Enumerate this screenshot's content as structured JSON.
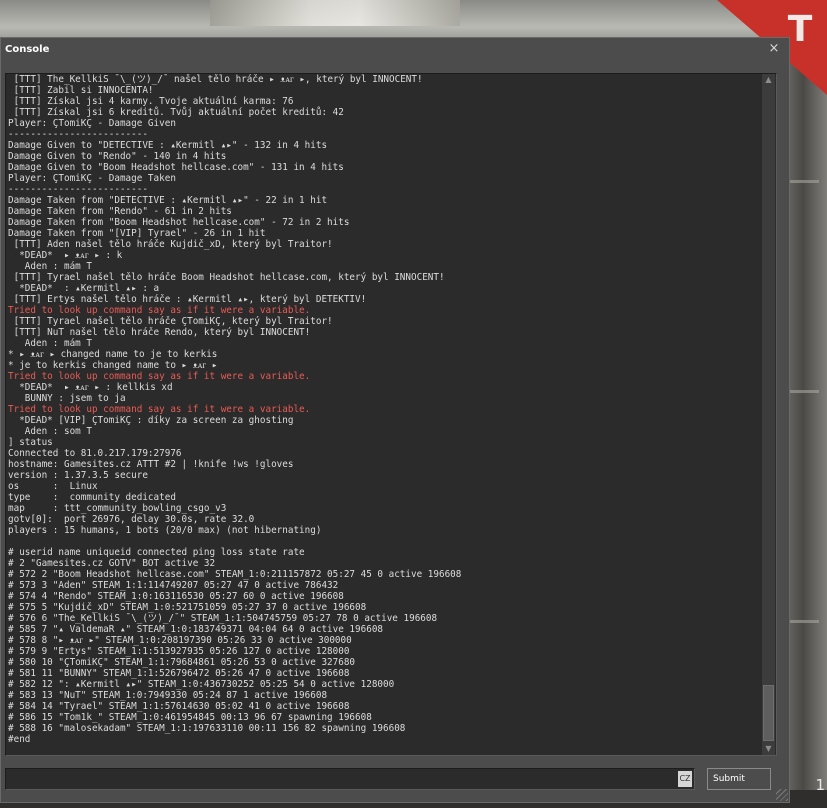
{
  "window": {
    "title": "Console",
    "close_glyph": "×"
  },
  "console_lines": [
    {
      "text": " [TTT] The_KellkiS ¯\\_(ツ)_/¯ našel tělo hráče ▸ ᴥᴀᴦ ▸, který byl INNOCENT!",
      "red": false
    },
    {
      "text": " [TTT] Zabil si INNOCENTA!",
      "red": false
    },
    {
      "text": " [TTT] Získal jsi 4 karmy. Tvoje aktuální karma: 76",
      "red": false
    },
    {
      "text": " [TTT] Získal jsi 6 kreditů. Tvůj aktuální počet kreditů: 42",
      "red": false
    },
    {
      "text": "Player: ÇTomiKÇ - Damage Given",
      "red": false
    },
    {
      "text": "-------------------------",
      "red": false
    },
    {
      "text": "Damage Given to \"DETECTIVE : ▴Kermitl ▴▸\" - 132 in 4 hits",
      "red": false
    },
    {
      "text": "Damage Given to \"Rendo\" - 140 in 4 hits",
      "red": false
    },
    {
      "text": "Damage Given to \"Boom Headshot hellcase.com\" - 131 in 4 hits",
      "red": false
    },
    {
      "text": "Player: ÇTomiKÇ - Damage Taken",
      "red": false
    },
    {
      "text": "-------------------------",
      "red": false
    },
    {
      "text": "Damage Taken from \"DETECTIVE : ▴Kermitl ▴▸\" - 22 in 1 hit",
      "red": false
    },
    {
      "text": "Damage Taken from \"Rendo\" - 61 in 2 hits",
      "red": false
    },
    {
      "text": "Damage Taken from \"Boom Headshot hellcase.com\" - 72 in 2 hits",
      "red": false
    },
    {
      "text": "Damage Taken from \"[VIP] Tyrael\" - 26 in 1 hit",
      "red": false
    },
    {
      "text": " [TTT] Aden našel tělo hráče Kujdič_xD, který byl Traitor!",
      "red": false
    },
    {
      "text": "  *DEAD*  ▸ ᴥᴀᴦ ▸ : k",
      "red": false
    },
    {
      "text": "   Aden : mám T",
      "red": false
    },
    {
      "text": " [TTT] Tyrael našel tělo hráče Boom Headshot hellcase.com, který byl INNOCENT!",
      "red": false
    },
    {
      "text": "  *DEAD*  : ▴Kermitl ▴▸ : a",
      "red": false
    },
    {
      "text": " [TTT] Ertys našel tělo hráče : ▴Kermitl ▴▸, který byl DETEKTIV!",
      "red": false
    },
    {
      "text": "Tried to look up command say as if it were a variable.",
      "red": true
    },
    {
      "text": " [TTT] Tyrael našel tělo hráče ÇTomiKÇ, který byl Traitor!",
      "red": false
    },
    {
      "text": " [TTT] NuT našel tělo hráče Rendo, který byl INNOCENT!",
      "red": false
    },
    {
      "text": "   Aden : mám T",
      "red": false
    },
    {
      "text": "* ▸ ᴥᴀᴦ ▸ changed name to je to kerkis",
      "red": false
    },
    {
      "text": "* je to kerkis changed name to ▸ ᴥᴀᴦ ▸",
      "red": false
    },
    {
      "text": "Tried to look up command say as if it were a variable.",
      "red": true
    },
    {
      "text": "  *DEAD*  ▸ ᴥᴀᴦ ▸ : kellkis xd",
      "red": false
    },
    {
      "text": "   BUNNY : jsem to ja",
      "red": false
    },
    {
      "text": "Tried to look up command say as if it were a variable.",
      "red": true
    },
    {
      "text": "  *DEAD* [VIP] ÇTomiKÇ : díky za screen za ghosting",
      "red": false
    },
    {
      "text": "   Aden : som T",
      "red": false
    },
    {
      "text": "] status",
      "red": false
    },
    {
      "text": "Connected to 81.0.217.179:27976",
      "red": false
    },
    {
      "text": "hostname: Gamesites.cz ATTT #2 | !knife !ws !gloves",
      "red": false
    },
    {
      "text": "version : 1.37.3.5 secure",
      "red": false
    },
    {
      "text": "os      :  Linux",
      "red": false
    },
    {
      "text": "type    :  community dedicated",
      "red": false
    },
    {
      "text": "map     : ttt_community_bowling_csgo_v3",
      "red": false
    },
    {
      "text": "gotv[0]:  port 26976, delay 30.0s, rate 32.0",
      "red": false
    },
    {
      "text": "players : 15 humans, 1 bots (20/0 max) (not hibernating)",
      "red": false
    },
    {
      "text": "",
      "red": false
    },
    {
      "text": "# userid name uniqueid connected ping loss state rate",
      "red": false
    },
    {
      "text": "# 2 \"Gamesites.cz GOTV\" BOT active 32",
      "red": false
    },
    {
      "text": "# 572 2 \"Boom Headshot hellcase.com\" STEAM_1:0:211157872 05:27 45 0 active 196608",
      "red": false
    },
    {
      "text": "# 573 3 \"Aden\" STEAM_1:1:114749207 05:27 47 0 active 786432",
      "red": false
    },
    {
      "text": "# 574 4 \"Rendo\" STEAM_1:0:163116530 05:27 60 0 active 196608",
      "red": false
    },
    {
      "text": "# 575 5 \"Kujdič_xD\" STEAM_1:0:521751059 05:27 37 0 active 196608",
      "red": false
    },
    {
      "text": "# 576 6 \"The_KellkiS ¯\\_(ツ)_/¯\" STEAM_1:1:504745759 05:27 78 0 active 196608",
      "red": false
    },
    {
      "text": "# 585 7 \"▴ ValdemaR ▴\" STEAM_1:0:183749371 04:04 64 0 active 196608",
      "red": false
    },
    {
      "text": "# 578 8 \"▸ ᴥᴀᴦ ▸\" STEAM_1:0:208197390 05:26 33 0 active 300000",
      "red": false
    },
    {
      "text": "# 579 9 \"Ertys\" STEAM_1:1:513927935 05:26 127 0 active 128000",
      "red": false
    },
    {
      "text": "# 580 10 \"ÇTomiKÇ\" STEAM_1:1:79684861 05:26 53 0 active 327680",
      "red": false
    },
    {
      "text": "# 581 11 \"BUNNY\" STEAM_1:1:526796472 05:26 47 0 active 196608",
      "red": false
    },
    {
      "text": "# 582 12 \": ▴Kermitl ▴▸\" STEAM_1:0:436730252 05:25 54 0 active 128000",
      "red": false
    },
    {
      "text": "# 583 13 \"NuT\" STEAM_1:0:7949330 05:24 87 1 active 196608",
      "red": false
    },
    {
      "text": "# 584 14 \"Tyrael\" STEAM_1:1:57614630 05:02 41 0 active 196608",
      "red": false
    },
    {
      "text": "# 586 15 \"Tom1k_\" STEAM_1:0:461954845 00:13 96 67 spawning 196608",
      "red": false
    },
    {
      "text": "# 588 16 \"malosekadam\" STEAM_1:1:197633110 00:11 156 82 spawning 196608",
      "red": false
    },
    {
      "text": "#end",
      "red": false
    }
  ],
  "input": {
    "value": "",
    "language_badge": "CZ",
    "submit_label": "Submit"
  },
  "scrollbar": {
    "up_glyph": "▲",
    "down_glyph": "▼"
  },
  "background": {
    "sign_letter": "T",
    "hud_number": "1"
  },
  "colors": {
    "console_bg": "#4c4c4c",
    "output_bg": "#2b2b2b",
    "text": "#dcdcdc",
    "error_text": "#e85b55",
    "sign_red": "#c8302a"
  }
}
